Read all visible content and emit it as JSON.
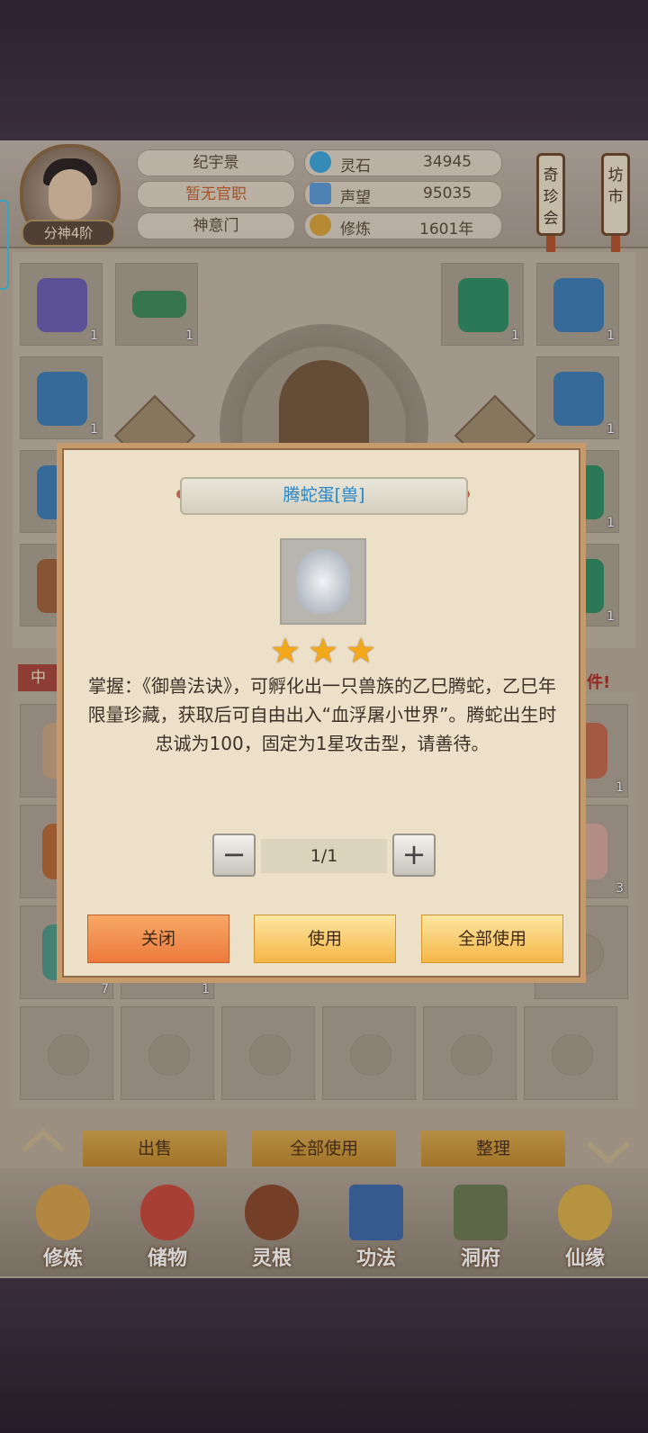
{
  "header": {
    "player_name": "纪宇景",
    "official_title": "暂无官职",
    "sect": "神意门",
    "rank": "分神4阶",
    "resources": [
      {
        "label": "灵石",
        "value": "34945",
        "icon": "spirit-stone-icon",
        "color": "#3aa7d8"
      },
      {
        "label": "声望",
        "value": "95035",
        "icon": "prestige-icon",
        "color": "#5b9ad6"
      },
      {
        "label": "修炼",
        "value": "1601年",
        "icon": "meditation-icon",
        "color": "#d9a43a"
      }
    ],
    "side_buttons": [
      "奇珍会",
      "坊市"
    ]
  },
  "equipment": {
    "slots": [
      {
        "count": "1",
        "icon": "boots-icon"
      },
      {
        "count": "1",
        "icon": "sword-icon"
      },
      {
        "count": "1",
        "icon": "green-armor-icon"
      },
      {
        "count": "1",
        "icon": "winged-armor-icon"
      },
      {
        "count": "1",
        "icon": "winged-armor-icon"
      },
      {
        "count": "1",
        "icon": "winged-armor-icon"
      },
      {
        "count": "1",
        "icon": "green-armor-icon"
      },
      {
        "count": "1",
        "icon": "green-armor-icon"
      }
    ]
  },
  "bag": {
    "category_tab": "中",
    "notice": "多件!",
    "counts": [
      "1",
      "3",
      "7",
      "1"
    ]
  },
  "bag_actions": {
    "sell": "出售",
    "use_all": "全部使用",
    "organize": "整理"
  },
  "nav": [
    {
      "label": "修炼",
      "icon": "cultivate-icon"
    },
    {
      "label": "储物",
      "icon": "storage-bag-icon"
    },
    {
      "label": "灵根",
      "icon": "spirit-root-icon"
    },
    {
      "label": "功法",
      "icon": "technique-book-icon"
    },
    {
      "label": "洞府",
      "icon": "cave-dwelling-icon"
    },
    {
      "label": "仙缘",
      "icon": "immortal-fate-icon"
    }
  ],
  "modal": {
    "title": "腾蛇蛋[兽]",
    "item_icon": "serpent-dragon-egg-icon",
    "stars": 3,
    "description": "掌握：《御兽法诀》，可孵化出一只兽族的乙巳腾蛇，乙巳年限量珍藏，获取后可自由出入“血浮屠小世界”。腾蛇出生时忠诚为100，固定为1星攻击型，请善待。",
    "quantity": "1/1",
    "buttons": {
      "close": "关闭",
      "use": "使用",
      "use_all": "全部使用"
    }
  }
}
